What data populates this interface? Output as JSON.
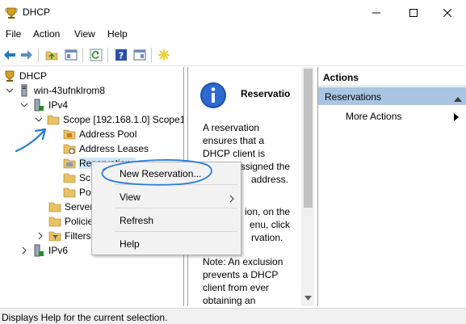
{
  "window": {
    "title": "DHCP",
    "icon": "dhcp-trophy-icon"
  },
  "menu": [
    "File",
    "Action",
    "View",
    "Help"
  ],
  "tree": {
    "root": "DHCP",
    "server": "win-43ufnklrom8",
    "ipv4": "IPv4",
    "scope": "Scope [192.168.1.0] Scope1",
    "address_pool": "Address Pool",
    "address_leases": "Address Leases",
    "reservations": "Reservations",
    "scope_options_partial": "Sc",
    "policies_partial": "Po",
    "server_options_partial": "Server",
    "policies_root_partial": "Policie",
    "filters": "Filters",
    "ipv6": "IPv6"
  },
  "middle": {
    "title": "Reservatio",
    "para1": [
      "A reservation",
      "ensures that a",
      "DHCP client is",
      "always assigned the",
      "address."
    ],
    "para2": [
      "ion, on the",
      "enu, click",
      "rvation."
    ],
    "para3": [
      "Note: An exclusion",
      "prevents a DHCP",
      "client from ever",
      "obtaining an"
    ]
  },
  "actions": {
    "header": "Actions",
    "section": "Reservations",
    "more": "More Actions"
  },
  "context_menu": {
    "new_reservation": "New Reservation...",
    "view": "View",
    "refresh": "Refresh",
    "help": "Help"
  },
  "status": "Displays Help for the current selection.",
  "colors": {
    "annotation_blue": "#2a7bd6",
    "selection": "#cce8ff",
    "actions_section": "#a9c5e3",
    "folder": "#e8c162"
  }
}
